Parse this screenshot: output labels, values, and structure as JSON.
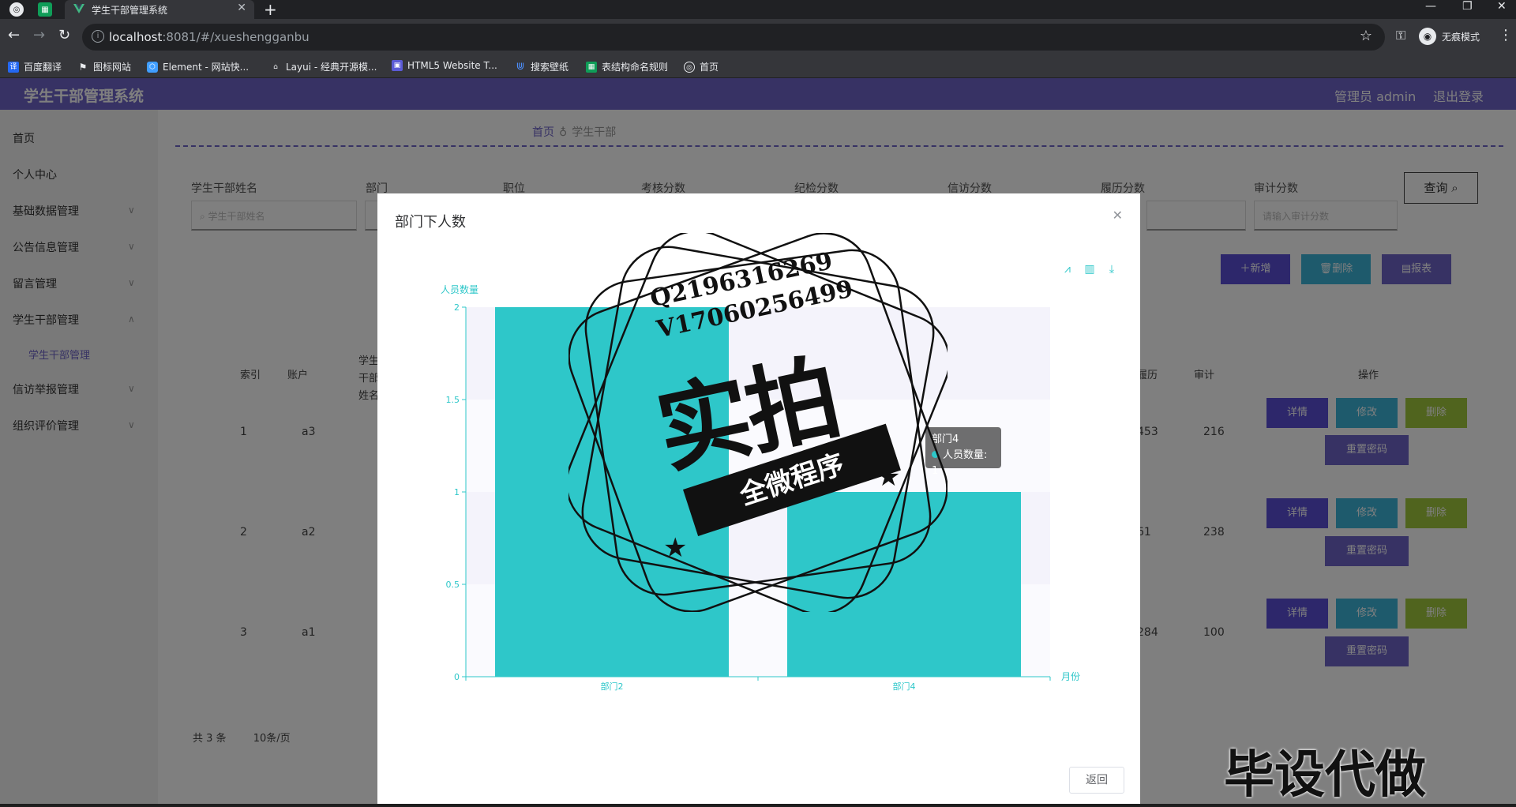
{
  "browser": {
    "tab_title": "学生干部管理系统",
    "url_host": "localhost",
    "url_rest": ":8081/#/xueshengganbu",
    "incognito_label": "无痕模式",
    "bookmarks": [
      "百度翻译",
      "图标网站",
      "Element - 网站快...",
      "Layui - 经典开源模...",
      "HTML5 Website T...",
      "搜索壁纸",
      "表结构命名规则",
      "首页"
    ]
  },
  "app": {
    "title": "学生干部管理系统",
    "admin_label": "管理员 admin",
    "logout": "退出登录"
  },
  "sidebar": {
    "items": [
      "首页",
      "个人中心",
      "基础数据管理",
      "公告信息管理",
      "留言管理",
      "学生干部管理",
      "学生干部管理",
      "信访举报管理",
      "组织评价管理"
    ]
  },
  "breadcrumb": {
    "home": "首页",
    "current": "学生干部"
  },
  "filters": {
    "labels": [
      "学生干部姓名",
      "部门",
      "职位",
      "考核分数",
      "纪检分数",
      "信访分数",
      "履历分数",
      "审计分数"
    ],
    "name_placeholder": "学生干部姓名",
    "audit_placeholder": "请输入审计分数",
    "query_button": "查询"
  },
  "actions": {
    "add": "新增",
    "delete": "删除",
    "report": "报表"
  },
  "table": {
    "headers": [
      "索引",
      "账户",
      "学生干部姓名",
      "履历",
      "审计",
      "操作"
    ],
    "rows": [
      {
        "index": "1",
        "account": "a3",
        "resume": "453",
        "audit": "216"
      },
      {
        "index": "2",
        "account": "a2",
        "resume": "61",
        "audit": "238"
      },
      {
        "index": "3",
        "account": "a1",
        "resume": "284",
        "audit": "100"
      }
    ],
    "row_buttons": {
      "detail": "详情",
      "edit": "修改",
      "delete": "删除",
      "reset": "重置密码"
    }
  },
  "pagination": {
    "total": "共 3 条",
    "page_size": "10条/页"
  },
  "dialog": {
    "title": "部门下人数",
    "back_button": "返回",
    "tooltip_name": "部门4",
    "tooltip_value": "人员数量: 1"
  },
  "chart_data": {
    "type": "bar",
    "categories": [
      "部门2",
      "部门4"
    ],
    "values": [
      2,
      1
    ],
    "ylabel": "人员数量",
    "xlabel": "月份",
    "ylim": [
      0,
      2
    ],
    "yticks": [
      "0",
      "0.5",
      "1",
      "1.5",
      "2"
    ],
    "color": "#2ec7c9"
  },
  "watermarks": {
    "contact_q": "Q2196316269",
    "contact_v": "V17060256499",
    "stamp_big": "实拍",
    "stamp_banner": "全微程序",
    "bottom": "毕设代做"
  }
}
